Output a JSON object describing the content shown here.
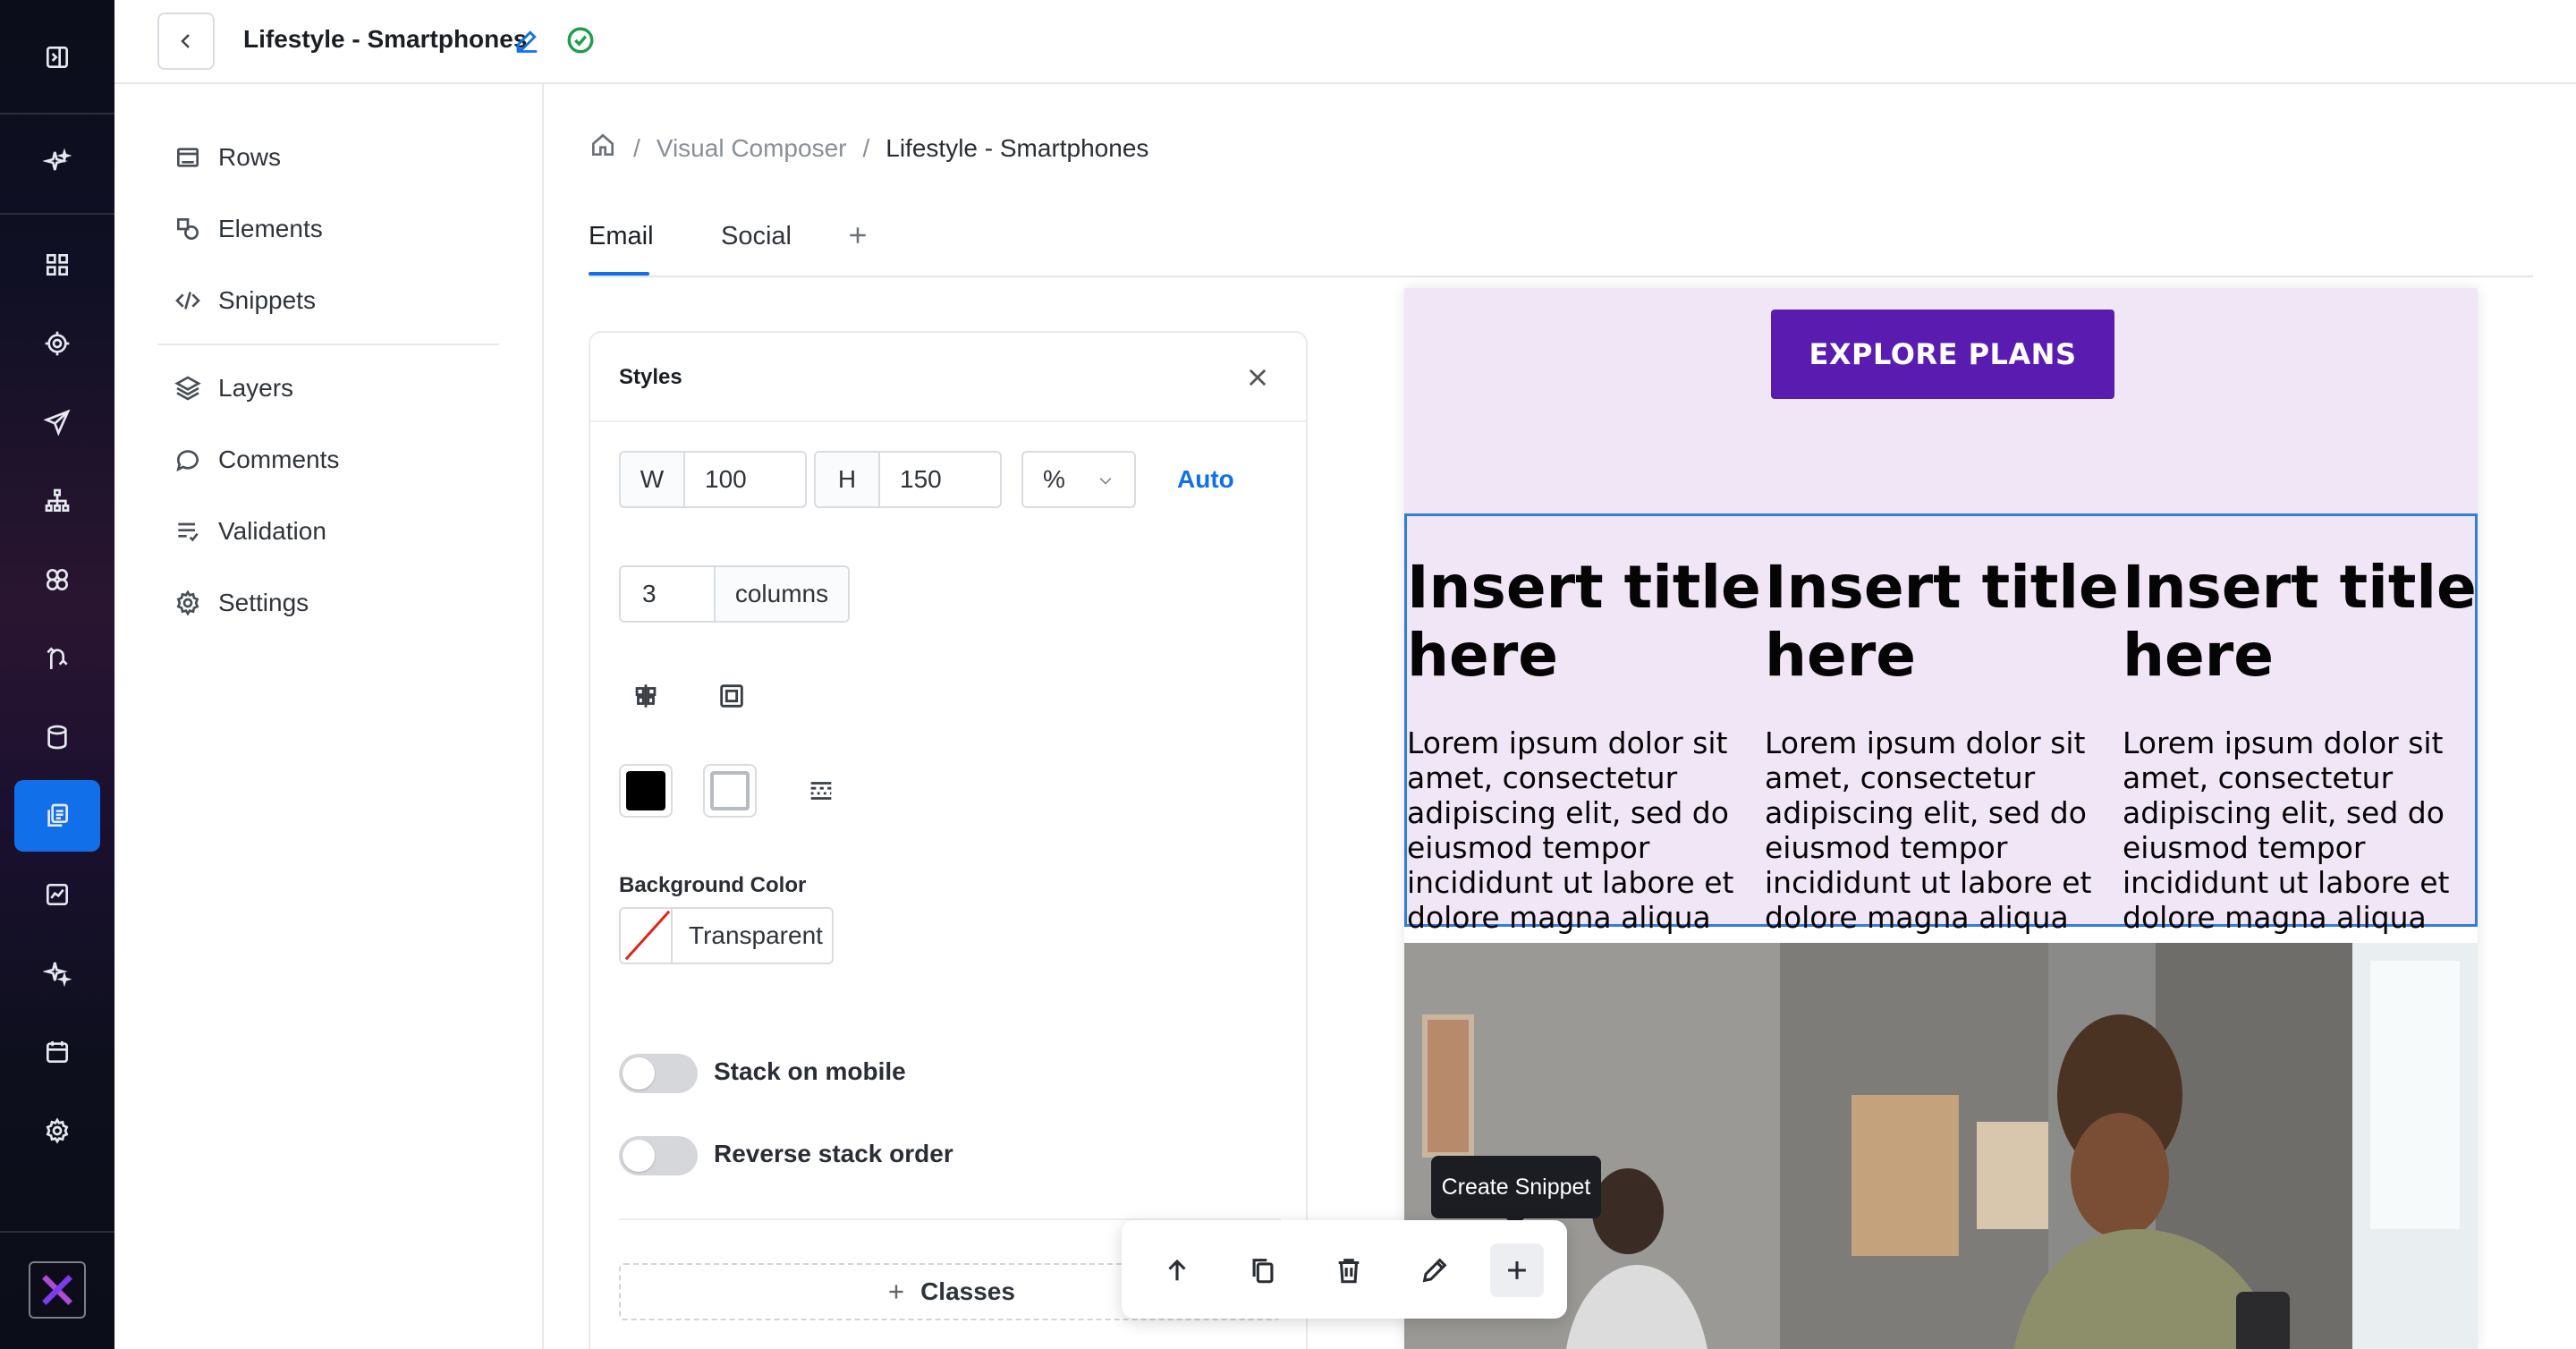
{
  "header": {
    "title": "Lifestyle - Smartphones"
  },
  "sidebar": {
    "items": [
      {
        "label": "Rows",
        "icon": "rows-icon"
      },
      {
        "label": "Elements",
        "icon": "elements-icon"
      },
      {
        "label": "Snippets",
        "icon": "code-icon"
      },
      {
        "label": "Layers",
        "icon": "layers-icon"
      },
      {
        "label": "Comments",
        "icon": "comment-icon"
      },
      {
        "label": "Validation",
        "icon": "checklist-icon"
      },
      {
        "label": "Settings",
        "icon": "gear-icon"
      }
    ]
  },
  "breadcrumb": {
    "section": "Visual Composer",
    "current": "Lifestyle - Smartphones",
    "separator": "/"
  },
  "tabs": [
    {
      "label": "Email",
      "active": true
    },
    {
      "label": "Social",
      "active": false
    }
  ],
  "styles_panel": {
    "title": "Styles",
    "width_label": "W",
    "width_value": "100",
    "height_label": "H",
    "height_value": "150",
    "unit": "%",
    "auto_label": "Auto",
    "columns_value": "3",
    "columns_label": "columns",
    "background_label": "Background Color",
    "background_value": "Transparent",
    "stack_mobile_label": "Stack on mobile",
    "stack_mobile_on": false,
    "reverse_stack_label": "Reverse stack order",
    "reverse_stack_on": false,
    "classes_label": "Classes"
  },
  "email": {
    "cta_label": "EXPLORE PLANS",
    "columns": [
      {
        "title": "Insert title here",
        "body": "Lorem ipsum dolor sit amet, consectetur adipiscing elit, sed do eiusmod tempor incididunt ut labore et dolore magna aliqua"
      },
      {
        "title": "Insert title here",
        "body": "Lorem ipsum dolor sit amet, consectetur adipiscing elit, sed do eiusmod tempor incididunt ut labore et dolore magna aliqua"
      },
      {
        "title": "Insert title here",
        "body": "Lorem ipsum dolor sit amet, consectetur adipiscing elit, sed do eiusmod tempor incididunt ut labore et dolore magna aliqua"
      }
    ]
  },
  "tooltip": {
    "text": "Create Snippet"
  },
  "colors": {
    "accent": "#1170e9",
    "cta": "#5a1cb0",
    "email_bg": "#f1e6f6",
    "selection": "#2f7de1"
  }
}
